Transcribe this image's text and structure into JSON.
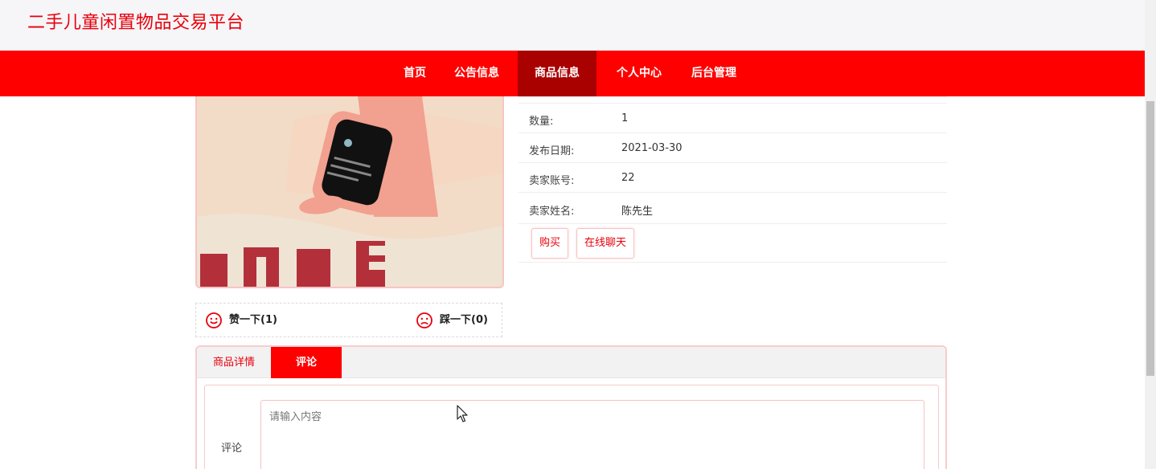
{
  "header": {
    "site_title": "二手儿童闲置物品交易平台"
  },
  "nav": {
    "items": [
      {
        "label": "首页",
        "active": false
      },
      {
        "label": "公告信息",
        "active": false
      },
      {
        "label": "商品信息",
        "active": true
      },
      {
        "label": "个人中心",
        "active": false
      },
      {
        "label": "后台管理",
        "active": false
      }
    ]
  },
  "product": {
    "image_icon": "kids-smartwatch-photo",
    "details": [
      {
        "label": "数量:",
        "value": "1"
      },
      {
        "label": "发布日期:",
        "value": "2021-03-30"
      },
      {
        "label": "卖家账号:",
        "value": "22"
      },
      {
        "label": "卖家姓名:",
        "value": "陈先生"
      }
    ],
    "actions": {
      "buy": "购买",
      "chat": "在线聊天"
    }
  },
  "votes": {
    "like": {
      "label": "赞一下(1)",
      "icon": "smile-icon"
    },
    "dislike": {
      "label": "踩一下(0)",
      "icon": "frown-icon"
    }
  },
  "tabs": {
    "items": [
      {
        "label": "商品详情",
        "active": false
      },
      {
        "label": "评论",
        "active": true
      }
    ]
  },
  "comment": {
    "label": "评论",
    "placeholder": "请输入内容",
    "value": ""
  },
  "colors": {
    "accent": "#ff0000",
    "nav_active": "#a90000",
    "title": "#e8000b"
  }
}
